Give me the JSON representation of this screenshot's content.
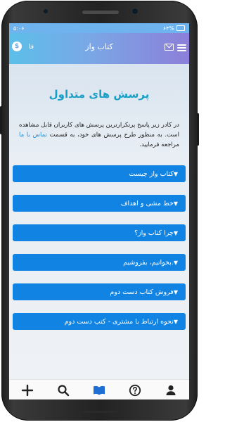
{
  "status": {
    "time": "۵:۰۶",
    "battery": "۶۴%"
  },
  "appbar": {
    "title": "کتاب واز",
    "lang": "فا",
    "wallet_symbol": "$"
  },
  "page": {
    "heading": "پرسش های متداول",
    "intro_text": "در کادر زیر پاسخ پرتکرارترین پرسش های کاربران قابل مشاهده است. به منظور طرح پرسش های خود، به قسمت",
    "intro_link": "تماس با ما",
    "intro_tail": "مراجعه فرمایید."
  },
  "faqs": [
    {
      "label": "کتاب واز چیست"
    },
    {
      "label": "خط مشی و اهداف"
    },
    {
      "label": "چرا کتاب واز؟"
    },
    {
      "label": "بخوانیم، بفروشیم."
    },
    {
      "label": "فروش کتاب دست دوم"
    },
    {
      "label": "نحوه ارتباط با مشتری - کتب دست دوم"
    }
  ],
  "bottom_nav": [
    {
      "icon": "add-icon"
    },
    {
      "icon": "search-icon"
    },
    {
      "icon": "book-icon",
      "active": true
    },
    {
      "icon": "help-icon"
    },
    {
      "icon": "user-icon"
    }
  ],
  "colors": {
    "accent": "#1183e3",
    "heading": "#1aa0c7",
    "appbar_start": "#5bbfe9",
    "appbar_end": "#8c7fd9"
  }
}
